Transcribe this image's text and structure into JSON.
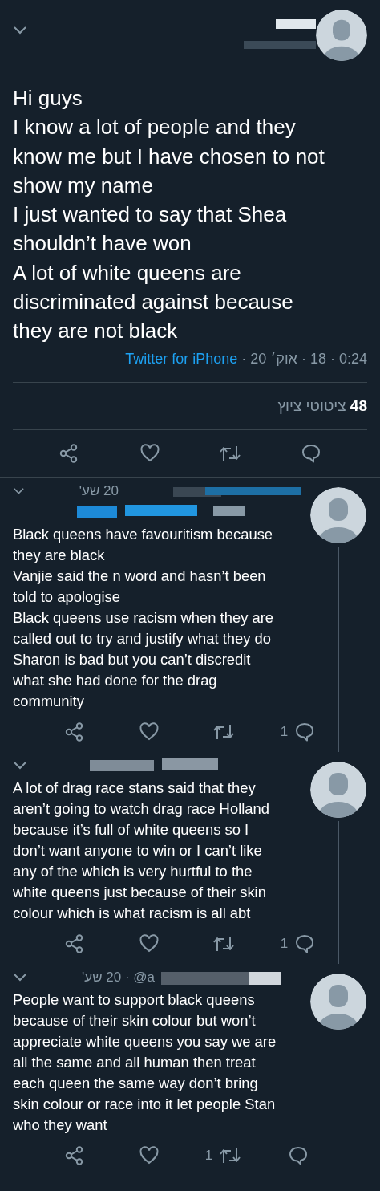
{
  "main_tweet": {
    "text_lines": [
      "Hi guys",
      "I know a lot of people and they",
      "know me but I have chosen to not",
      "show my name",
      "I just wanted to say that Shea",
      "shouldn’t have won",
      "A lot of white queens are",
      "discriminated against because",
      "they are not black"
    ],
    "source": "Twitter for iPhone",
    "separator": " · ",
    "date_parts": [
      "20 אוק׳",
      "18",
      "0:24"
    ],
    "quote_count": "48",
    "quote_label": "ציטוטי ציוץ",
    "actions": [
      {
        "kind": "share"
      },
      {
        "kind": "like"
      },
      {
        "kind": "retweet"
      },
      {
        "kind": "reply"
      }
    ]
  },
  "replies": [
    {
      "time": "20 שע'",
      "lines": [
        "Black queens have favouritism because",
        "they are black",
        "Vanjie said the n word and hasn’t been",
        "told to apologise",
        "Black queens use racism when they are",
        "called out to try and justify what they do",
        "Sharon is bad but you can’t discredit",
        "what she had done for the drag",
        "community"
      ],
      "actions": [
        {
          "kind": "share"
        },
        {
          "kind": "like"
        },
        {
          "kind": "retweet"
        },
        {
          "kind": "reply",
          "count": "1"
        }
      ]
    },
    {
      "lines": [
        "A lot of drag race stans said that they",
        "aren’t going to watch drag race Holland",
        "because it’s full of white queens so I",
        "don’t want anyone to win or I can’t like",
        "any of the which is very hurtful to the",
        "white queens just because of their skin",
        "colour which is what racism is all abt"
      ],
      "actions": [
        {
          "kind": "share"
        },
        {
          "kind": "like"
        },
        {
          "kind": "retweet"
        },
        {
          "kind": "reply",
          "count": "1"
        }
      ]
    },
    {
      "time": "20 שע'",
      "handle": " · @a",
      "lines": [
        "People want to support black queens",
        "because of their skin colour but won’t",
        "appreciate white queens  you say we are",
        "all the same and all human then treat",
        "each queen the same way don’t bring",
        "skin colour or race into it let people Stan",
        "who they want"
      ],
      "actions": [
        {
          "kind": "share"
        },
        {
          "kind": "like"
        },
        {
          "kind": "retweet",
          "count": "1"
        },
        {
          "kind": "reply"
        }
      ]
    }
  ]
}
